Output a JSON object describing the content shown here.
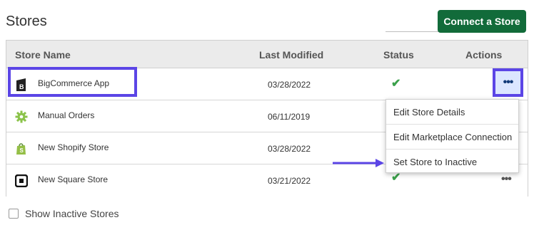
{
  "page": {
    "title": "Stores",
    "connect_button": "Connect a Store"
  },
  "table": {
    "headers": {
      "store_name": "Store Name",
      "last_modified": "Last Modified",
      "status": "Status",
      "actions": "Actions"
    },
    "rows": [
      {
        "name": "BigCommerce App",
        "date": "03/28/2022",
        "status": "active",
        "icon": "bigcommerce-icon",
        "actions_label": "•••"
      },
      {
        "name": "Manual Orders",
        "date": "06/11/2019",
        "status": "active",
        "icon": "gear-icon",
        "actions_label": "•••"
      },
      {
        "name": "New Shopify Store",
        "date": "03/28/2022",
        "status": "active",
        "icon": "shopify-bag-icon",
        "actions_label": "•••"
      },
      {
        "name": "New Square Store",
        "date": "03/21/2022",
        "status": "active",
        "icon": "square-icon",
        "actions_label": "•••"
      }
    ]
  },
  "actions_menu": {
    "items": [
      {
        "label": "Edit Store Details"
      },
      {
        "label": "Edit Marketplace Connection"
      },
      {
        "label": "Set Store to Inactive"
      }
    ]
  },
  "footer": {
    "show_inactive_label": "Show Inactive Stores",
    "show_inactive_checked": false
  },
  "colors": {
    "primary_button": "#126b3a",
    "highlight": "#5b45e6",
    "check": "#3aa04a",
    "shopify_green": "#95bf47",
    "gear_green": "#8bc34a"
  }
}
